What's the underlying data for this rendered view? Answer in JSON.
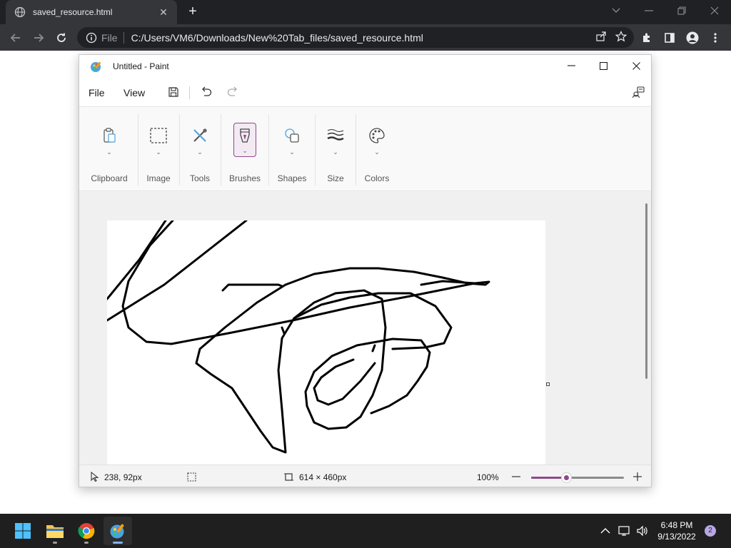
{
  "browser": {
    "tab_title": "saved_resource.html",
    "url_scheme": "File",
    "url": "C:/Users/VM6/Downloads/New%20Tab_files/saved_resource.html"
  },
  "paint": {
    "window_title": "Untitled - Paint",
    "menu": {
      "file": "File",
      "view": "View"
    },
    "ribbon_groups": [
      {
        "label": "Clipboard",
        "icon": "clipboard-icon"
      },
      {
        "label": "Image",
        "icon": "selection-icon"
      },
      {
        "label": "Tools",
        "icon": "tools-icon"
      },
      {
        "label": "Brushes",
        "icon": "brush-icon"
      },
      {
        "label": "Shapes",
        "icon": "shapes-icon"
      },
      {
        "label": "Size",
        "icon": "size-icon"
      },
      {
        "label": "Colors",
        "icon": "palette-icon"
      }
    ],
    "status": {
      "cursor_position": "238, 92px",
      "canvas_size": "614 × 460px",
      "zoom": "100%",
      "zoom_slider_fraction": 0.38
    },
    "accent_color": "#8e4a8c"
  },
  "taskbar": {
    "time": "6:48 PM",
    "date": "9/13/2022",
    "notification_count": "2"
  }
}
